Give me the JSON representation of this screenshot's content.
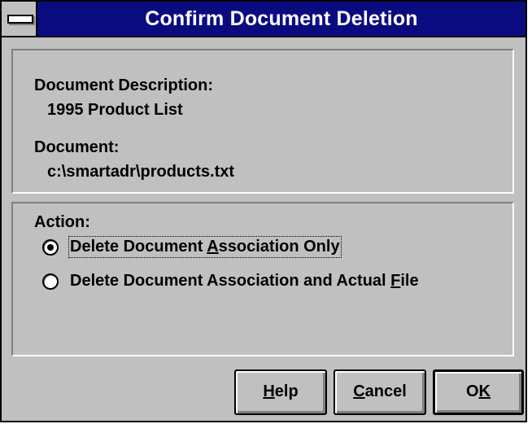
{
  "window": {
    "title": "Confirm Document Deletion",
    "system_menu_icon": "minus-bar-icon"
  },
  "info": {
    "description_label": "Document Description:",
    "description_value": "1995 Product List",
    "document_label": "Document:",
    "document_value": "c:\\smartadr\\products.txt"
  },
  "action": {
    "label": "Action:",
    "options": [
      {
        "pre": "Delete Document ",
        "key": "A",
        "post": "ssociation Only",
        "selected": true
      },
      {
        "pre": "Delete Document Association and Actual ",
        "key": "F",
        "post": "ile",
        "selected": false
      }
    ]
  },
  "buttons": [
    {
      "key": "H",
      "rest": "elp"
    },
    {
      "key": "C",
      "rest": "ancel"
    },
    {
      "pre": "O",
      "key": "K",
      "rest": ""
    }
  ]
}
